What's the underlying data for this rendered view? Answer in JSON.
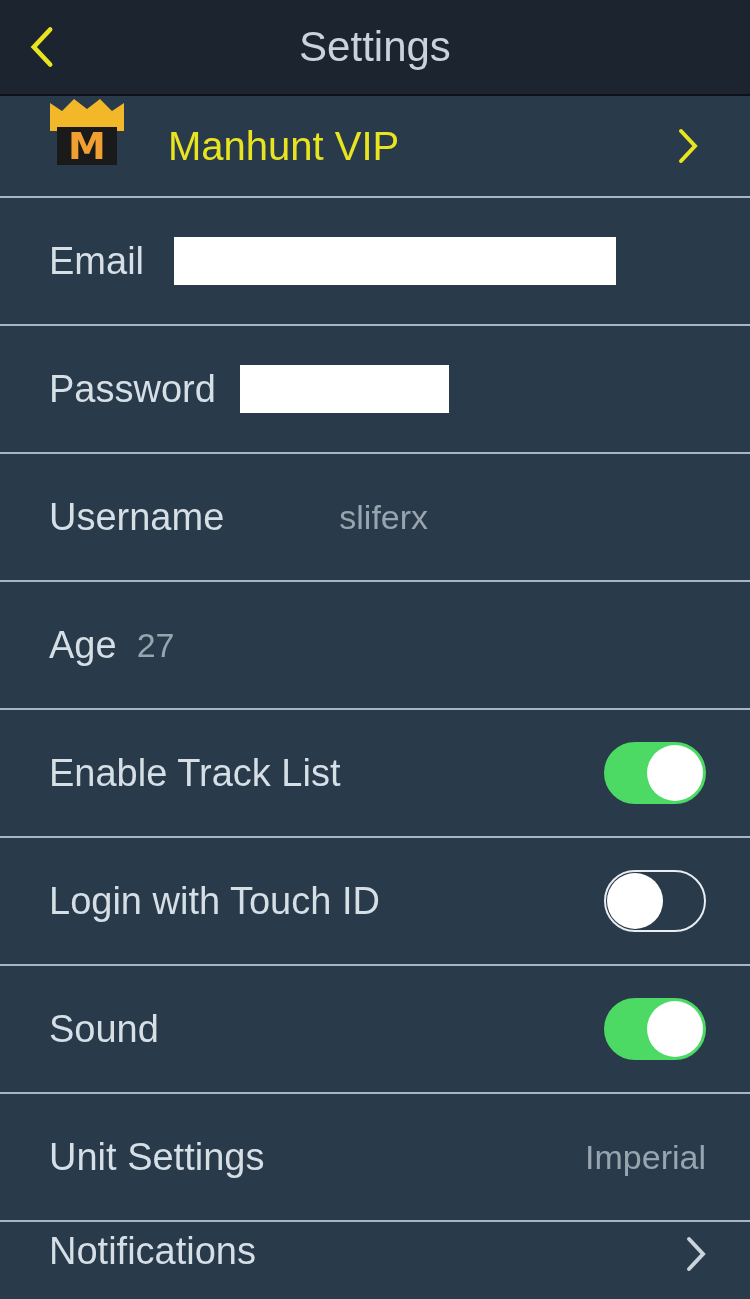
{
  "nav_bar": {
    "title": "Settings"
  },
  "vip_row": {
    "logo_letter": "M",
    "label": "Manhunt VIP"
  },
  "rows": [
    {
      "kind": "redacted",
      "label": "Email"
    },
    {
      "kind": "redacted",
      "label": "Password"
    },
    {
      "kind": "field",
      "label": "Username",
      "value": "sliferx"
    },
    {
      "kind": "inline",
      "label": "Age",
      "value": "27"
    },
    {
      "kind": "toggle",
      "label": "Enable Track List",
      "on": true
    },
    {
      "kind": "toggle",
      "label": "Login with Touch ID",
      "on": false
    },
    {
      "kind": "toggle",
      "label": "Sound",
      "on": true
    },
    {
      "kind": "detail",
      "label": "Unit Settings",
      "value": "Imperial"
    },
    {
      "kind": "link",
      "label": "Notifications"
    }
  ]
}
